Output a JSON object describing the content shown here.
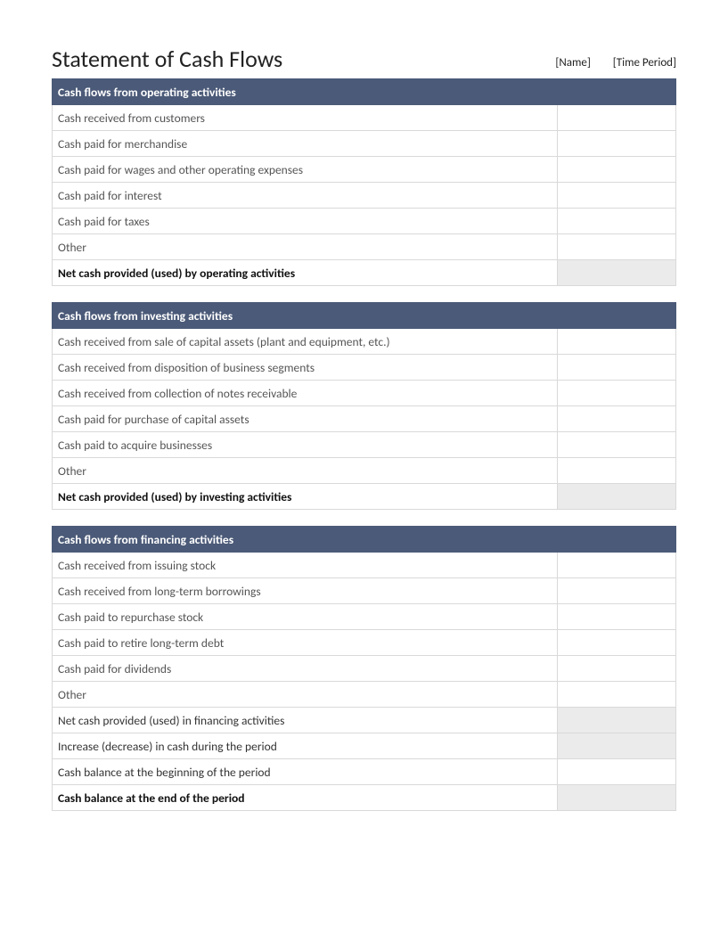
{
  "title": "Statement of Cash Flows",
  "meta": {
    "name": "[Name]",
    "period": "[Time Period]"
  },
  "sections": [
    {
      "header": "Cash flows from operating activities",
      "lines": [
        {
          "label": "Cash received from customers",
          "value": ""
        },
        {
          "label": "Cash paid for merchandise",
          "value": ""
        },
        {
          "label": "Cash paid for wages and other operating expenses",
          "value": ""
        },
        {
          "label": "Cash paid for interest",
          "value": ""
        },
        {
          "label": "Cash paid for taxes",
          "value": ""
        },
        {
          "label": "Other",
          "value": ""
        }
      ],
      "subtotals": [
        {
          "label": "Net cash provided (used) by operating activities",
          "value": "",
          "bold": true,
          "shaded": true
        }
      ]
    },
    {
      "header": "Cash flows from investing activities",
      "lines": [
        {
          "label": "Cash received from sale of capital assets (plant and equipment, etc.)",
          "value": ""
        },
        {
          "label": "Cash received from disposition of business segments",
          "value": ""
        },
        {
          "label": "Cash received from collection of notes receivable",
          "value": ""
        },
        {
          "label": "Cash paid for purchase of capital assets",
          "value": ""
        },
        {
          "label": "Cash paid to acquire businesses",
          "value": ""
        },
        {
          "label": "Other",
          "value": ""
        }
      ],
      "subtotals": [
        {
          "label": "Net cash provided (used) by investing activities",
          "value": "",
          "bold": true,
          "shaded": true
        }
      ]
    },
    {
      "header": "Cash flows from financing activities",
      "lines": [
        {
          "label": "Cash received from issuing stock",
          "value": ""
        },
        {
          "label": "Cash received from long-term borrowings",
          "value": ""
        },
        {
          "label": "Cash paid to repurchase stock",
          "value": ""
        },
        {
          "label": "Cash paid to retire long-term debt",
          "value": ""
        },
        {
          "label": "Cash paid for dividends",
          "value": ""
        },
        {
          "label": "Other",
          "value": ""
        }
      ],
      "subtotals": [
        {
          "label": "Net cash provided (used) in financing activities",
          "value": "",
          "bold": false,
          "shaded": true
        },
        {
          "label": "Increase (decrease) in cash during the period",
          "value": "",
          "bold": false,
          "shaded": true
        },
        {
          "label": "Cash balance at the beginning of the period",
          "value": "",
          "bold": false,
          "shaded": false
        },
        {
          "label": "Cash balance at the end of the period",
          "value": "",
          "bold": true,
          "shaded": true
        }
      ]
    }
  ]
}
